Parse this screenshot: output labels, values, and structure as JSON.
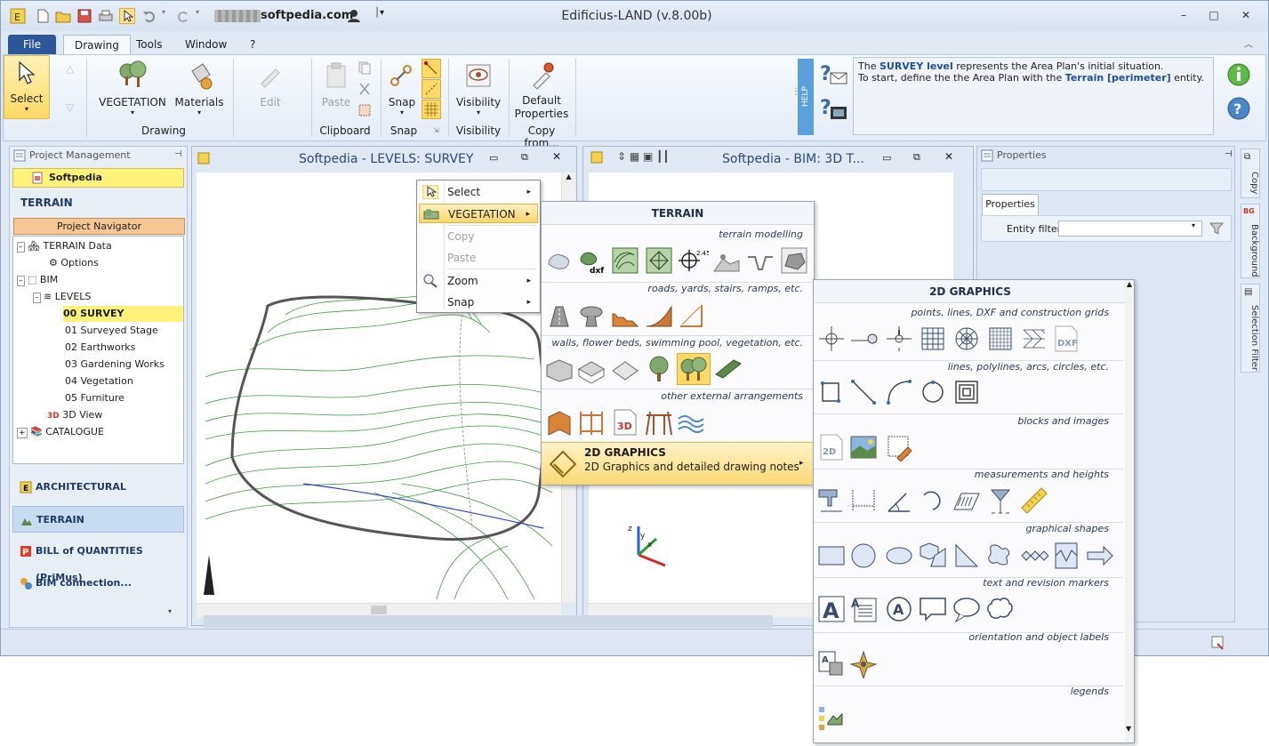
{
  "window": {
    "title": "Edificius-LAND (v.8.00b)",
    "domain": "softpedia.com",
    "minimize": "–",
    "maximize": "□",
    "close": "✕",
    "help": "?"
  },
  "menu": {
    "file": "File",
    "tabs": [
      "Drawing",
      "Tools",
      "Window",
      "?"
    ]
  },
  "ribbon": {
    "select": "Select",
    "vegetation": "VEGETATION",
    "materials": "Materials",
    "edit": "Edit",
    "paste": "Paste",
    "snap": "Snap",
    "visibility": "Visibility",
    "default_properties": "Default Properties",
    "group_drawing": "Drawing",
    "group_clipboard": "Clipboard",
    "group_snap": "Snap",
    "group_visibility": "Visibility",
    "group_copy_from": "Copy from...",
    "help_tab": "HELP",
    "help_text_1a": "The ",
    "help_text_1b": "SURVEY level",
    "help_text_1c": " represents the Area Plan's initial situation.",
    "help_text_2a": "To start, define the the Area Plan with the ",
    "help_text_2b": "Terrain [perimeter]",
    "help_text_2c": " entity."
  },
  "project": {
    "panel_title": "Project Management",
    "project_name": "Softpedia",
    "section": "TERRAIN",
    "navigator": "Project Navigator",
    "tree": [
      {
        "label": "TERRAIN Data"
      },
      {
        "label": "Options"
      },
      {
        "label": "BIM"
      },
      {
        "label": "LEVELS"
      },
      {
        "label": "00 SURVEY"
      },
      {
        "label": "01 Surveyed Stage"
      },
      {
        "label": "02 Earthworks"
      },
      {
        "label": "03 Gardening Works"
      },
      {
        "label": "04 Vegetation"
      },
      {
        "label": "05 Furniture"
      },
      {
        "label": "3D View"
      },
      {
        "label": "CATALOGUE"
      }
    ],
    "nav": [
      {
        "label": "ARCHITECTURAL"
      },
      {
        "label": "TERRAIN"
      },
      {
        "label": "BILL of QUANTITIES (PriMus)"
      },
      {
        "label": "BIM connection..."
      }
    ]
  },
  "views": {
    "left_title": "Softpedia -  LEVELS: SURVEY",
    "right_title": "Softpedia -  BIM: 3D T...",
    "axis_x": "x",
    "axis_y": "y",
    "axis_z": "z"
  },
  "properties": {
    "panel_title": "Properties",
    "tab": "Properties",
    "entity_filter_label": "Entity filter",
    "entity_filter_value": ""
  },
  "side_tabs": [
    "Copy",
    "Background",
    "Selection Filter"
  ],
  "context_menu": {
    "items": [
      {
        "label": "Select",
        "state": "normal"
      },
      {
        "label": "VEGETATION",
        "state": "highlighted"
      },
      {
        "label": "Copy",
        "state": "disabled"
      },
      {
        "label": "Paste",
        "state": "disabled"
      },
      {
        "label": "Zoom",
        "state": "normal"
      },
      {
        "label": "Snap",
        "state": "normal"
      }
    ]
  },
  "terrain_flyout": {
    "title": "TERRAIN",
    "sections": [
      "terrain modelling",
      "roads, yards, stairs, ramps, etc.",
      "walls, flower beds, swimming pool, vegetation, etc.",
      "other external arrangements"
    ],
    "graphics_title": "2D GRAPHICS",
    "graphics_sub": "2D Graphics and detailed drawing notes"
  },
  "graphics_flyout": {
    "title": "2D GRAPHICS",
    "sections": [
      "points, lines, DXF and construction grids",
      "lines, polylines, arcs, circles, etc.",
      "blocks and images",
      "measurements and heights",
      "graphical shapes",
      "text and revision markers",
      "orientation and object labels",
      "legends"
    ]
  },
  "colors": {
    "accent": "#2b579a",
    "highlight": "#fbd56a",
    "selection": "#fff27a",
    "contour": "#2e8b2e"
  }
}
